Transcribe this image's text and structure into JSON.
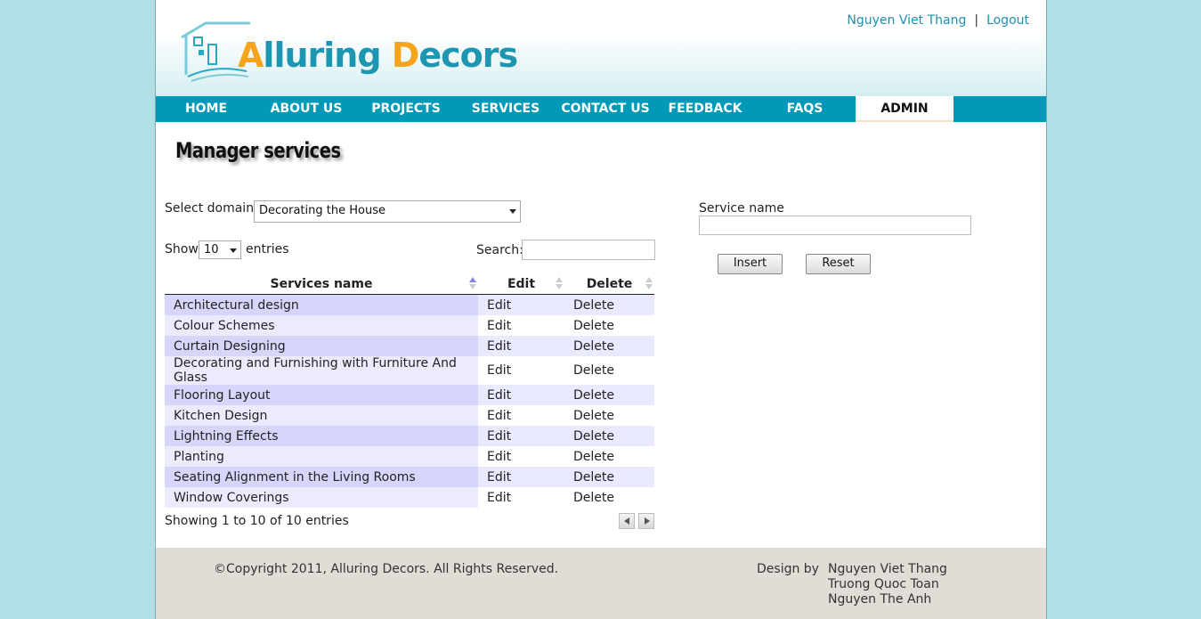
{
  "header": {
    "logo_cap1": "A",
    "logo_rest1": "lluring ",
    "logo_cap2": "D",
    "logo_rest2": "ecors",
    "user_name": "Nguyen Viet Thang",
    "separator": "|",
    "logout_label": "Logout"
  },
  "nav": {
    "items": [
      {
        "label": "HOME"
      },
      {
        "label": "ABOUT US"
      },
      {
        "label": "PROJECTS"
      },
      {
        "label": "SERVICES"
      },
      {
        "label": "CONTACT US"
      },
      {
        "label": "FEEDBACK"
      },
      {
        "label": "FAQS"
      },
      {
        "label": "ADMIN",
        "active": true
      }
    ]
  },
  "main": {
    "title": "Manager services",
    "select_domain_label": "Select domain",
    "select_domain_value": "Decorating the House",
    "show_label": "Show",
    "entries_value": "10",
    "entries_label": "entries",
    "search_label": "Search:",
    "table": {
      "headers": [
        "Services name",
        "Edit",
        "Delete"
      ],
      "rows": [
        {
          "name": "Architectural design",
          "edit": "Edit",
          "delete": "Delete"
        },
        {
          "name": "Colour Schemes",
          "edit": "Edit",
          "delete": "Delete"
        },
        {
          "name": "Curtain Designing",
          "edit": "Edit",
          "delete": "Delete"
        },
        {
          "name": "Decorating and Furnishing with Furniture And Glass",
          "edit": "Edit",
          "delete": "Delete"
        },
        {
          "name": "Flooring Layout",
          "edit": "Edit",
          "delete": "Delete"
        },
        {
          "name": "Kitchen Design",
          "edit": "Edit",
          "delete": "Delete"
        },
        {
          "name": "Lightning Effects",
          "edit": "Edit",
          "delete": "Delete"
        },
        {
          "name": "Planting",
          "edit": "Edit",
          "delete": "Delete"
        },
        {
          "name": "Seating Alignment in the Living Rooms",
          "edit": "Edit",
          "delete": "Delete"
        },
        {
          "name": "Window Coverings",
          "edit": "Edit",
          "delete": "Delete"
        }
      ]
    },
    "info": "Showing 1 to 10 of 10 entries",
    "form": {
      "service_name_label": "Service name",
      "service_name_value": "",
      "insert_label": "Insert",
      "reset_label": "Reset"
    }
  },
  "footer": {
    "copyright": "©Copyright 2011, Alluring Decors. All Rights Reserved.",
    "design_by_label": "Design by",
    "designers": [
      "Nguyen Viet Thang",
      "Truong Quoc Toan",
      "Nguyen The Anh"
    ]
  },
  "colors": {
    "background": "#b2dfe6",
    "nav": "#0099b7",
    "brand_orange": "#f4a51c",
    "brand_teal": "#1d96b2",
    "footer": "#e0dcd6"
  }
}
